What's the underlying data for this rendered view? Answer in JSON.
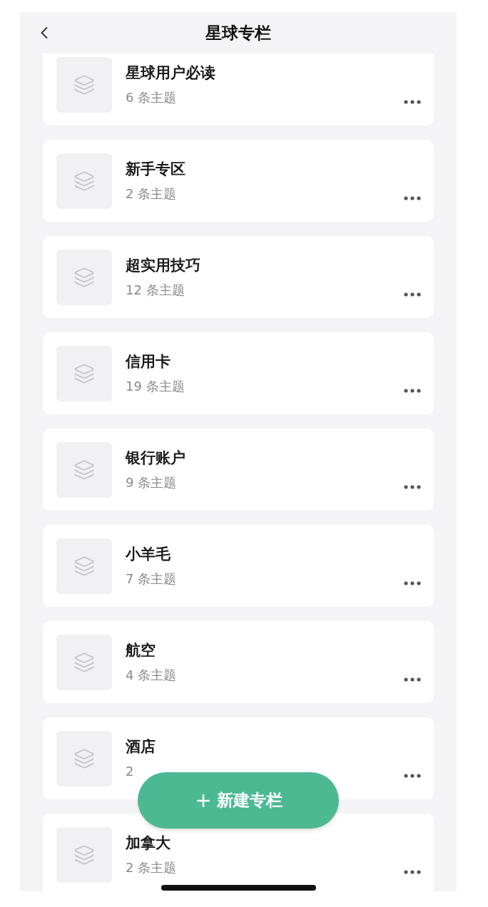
{
  "header": {
    "title": "星球专栏"
  },
  "columns": [
    {
      "name": "星球用户必读",
      "count": "6 条主题"
    },
    {
      "name": "新手专区",
      "count": "2 条主题"
    },
    {
      "name": "超实用技巧",
      "count": "12 条主题"
    },
    {
      "name": "信用卡",
      "count": "19 条主题"
    },
    {
      "name": "银行账户",
      "count": "9 条主题"
    },
    {
      "name": "小羊毛",
      "count": "7 条主题"
    },
    {
      "name": "航空",
      "count": "4 条主题"
    },
    {
      "name": "酒店",
      "count": "2"
    },
    {
      "name": "加拿大",
      "count": "2 条主题"
    }
  ],
  "new_button": {
    "label": "新建专栏"
  }
}
